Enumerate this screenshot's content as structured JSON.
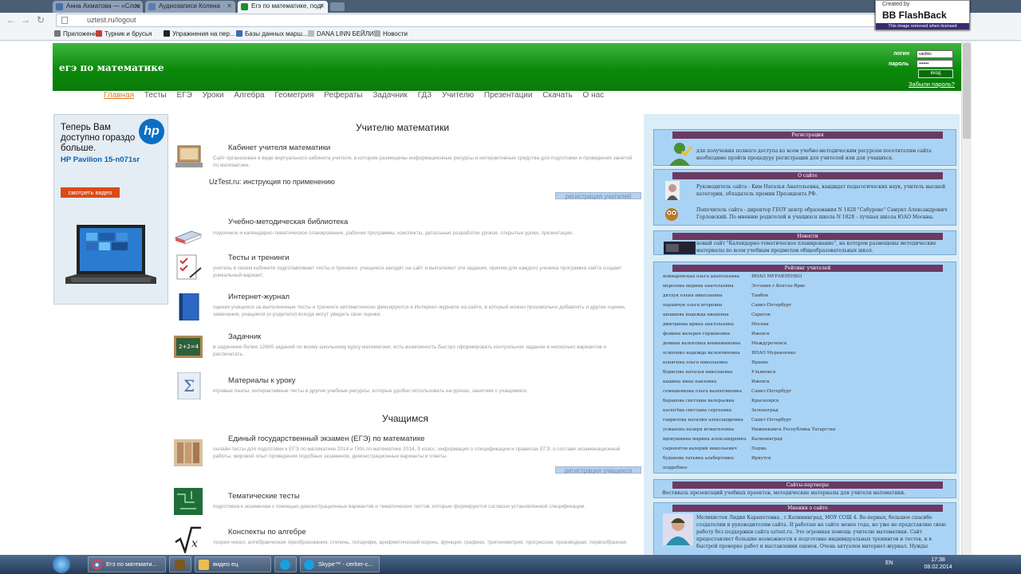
{
  "browser": {
    "tabs": [
      {
        "label": "Анна Ахматова — «Слов"
      },
      {
        "label": "Аудиозаписи Колена"
      },
      {
        "label": "Егэ по математике, подг"
      }
    ],
    "address": "uztest.ru/logout",
    "bookmarks": [
      "Приложения",
      "Турник и брусья",
      "Упражнения на пер...",
      "Базы данных марш...",
      "DANA LINN БЕЙЛИ",
      "Новости"
    ],
    "flashback": {
      "created_by": "Created by",
      "brand": "BB FlashBack",
      "note": "This image removed when licensed"
    }
  },
  "header": {
    "site_title": "егэ по математике",
    "login_label": "логин",
    "login_value": "vashko",
    "password_label": "пароль",
    "password_value": "•••••••",
    "enter_label": "вход",
    "forgot_label": "Забыли пароль?"
  },
  "menu": [
    "Главная",
    "Тесты",
    "ЕГЭ",
    "Уроки",
    "Алгебра",
    "Геометрия",
    "Рефераты",
    "Задачник",
    "ГДЗ",
    "Учителю",
    "Презентации",
    "Скачать",
    "О нас"
  ],
  "ad": {
    "text": "Теперь Вам доступно гораздо больше.",
    "model": "HP Pavilion 15-n071sr",
    "button": "смотреть видео",
    "logo": "hp"
  },
  "teachers": {
    "title": "Учителю математики",
    "items": [
      {
        "title": "Кабинет учителя математики",
        "desc": "Сайт организован в виде виртуального кабинета учителя, в котором размещены информационные ресурсы и интерактивные средства для подготовки и проведения занятий по математике."
      },
      {
        "title": "Учебно-методическая библиотека",
        "desc": "поурочное и календарно-тематическое планирование, рабочие программы, конспекты, детальные разработки уроков, открытые уроки, презентации."
      },
      {
        "title": "Тесты и тренинги",
        "desc": "учитель в своем кабинете подготавливает тесты и тренинги, учащиеся заходят на сайт и выполняют эти задания, причем для каждого ученика программа сайта создает уникальный вариант."
      },
      {
        "title": "Интернет-журнал",
        "desc": "оценки учащихся за выполненные тесты и тренинги автоматически фиксируются в Интернет-журнале на сайте, в который можно произвольно добавлять и другие оценки, замечания, учащиеся (и родители) всегда могут увидеть свои оценки."
      },
      {
        "title": "Задачник",
        "desc": "в задачнике более 12600 заданий по всему школьному курсу математики; есть возможность быстро сформировать контрольное задание в несколько вариантов и распечатать."
      },
      {
        "title": "Материалы к уроку",
        "desc": "игровые пазлы, интерактивные тесты и другие учебные ресурсы, которые удобно использовать на уроках, занятиях с учащимися."
      }
    ],
    "instructions_link": "UzTest.ru: инструкция по применению",
    "register_button": "регистрация учителей"
  },
  "students": {
    "title": "Учащимся",
    "items": [
      {
        "title": "Единый государственный экзамен (ЕГЭ) по математике",
        "desc": "онлайн тесты для подготовки к ЕГЭ по математике 2014 и ГИА по математике 2014, 9 класс, информация о спецификации и правилах ЕГЭ, о составе экзаменационной работы, мировой опыт проведения подобных экзаменов, демонстрационные варианты и ответы."
      },
      {
        "title": "Тематические тесты",
        "desc": "подготовка к экзаменам с помощью демонстрационных вариантов и тематических тестов, которые формируются согласно установленной спецификации."
      },
      {
        "title": "Конспекты по алгебре",
        "desc": "теория чисел, алгебраические преобразования, степень, логарифм, арифметический корень, функция, графики, тригонометрия, прогрессии, производная, первообразная"
      }
    ],
    "register_button": "регистрация учащихся"
  },
  "right": {
    "registration": {
      "title": "Регистрация",
      "text": "для получения полного доступа ко всем учебно-методическим ресурсам посетителям сайта необходимо пройти процедуру регистрации для учителей или для учащихся."
    },
    "about": {
      "title": "О сайте",
      "p1": "Руководитель сайта - Ким Наталья Анатольевна, кандидат педагогических наук, учитель высшей категории, обладатель премии Президента РФ.",
      "p2": "Попечитель сайта - директор ГБОУ центр образования N 1828 \"Сабурово\" Самуил Александрович Горловский. По мнению родителей и учащихся школа N 1828 - лучшая школа ЮАО Москвы."
    },
    "news": {
      "title": "Новости",
      "text": "новый сайт \"Календарно-тематическое планирование\", на котором размещены методические материалы по всем учебным предметам общеобразовательных школ."
    },
    "rating": {
      "title": "Рейтинг учителей",
      "rows": [
        {
          "name": "войнаровская ольга анатольевна",
          "place": "ЯНАО МУРАВЛЕНКО"
        },
        {
          "name": "морозова марина анатольевна",
          "place": "Эстония г.Кохтла-Ярве"
        },
        {
          "name": "дятлук елена николаевна",
          "place": "Тамбов"
        },
        {
          "name": "парамчук ольга игоревна",
          "place": "Санкт-Петербург"
        },
        {
          "name": "шешнева надежда ивановна",
          "place": "Саратов"
        },
        {
          "name": "дмитриева ирина анатольевна",
          "place": "Москва"
        },
        {
          "name": "фомина валерия германовна",
          "place": "Ижевск"
        },
        {
          "name": "демина валентина вениаминовна",
          "place": "Междуреченск"
        },
        {
          "name": "осипенко надежда валентиновна",
          "place": "ЯНАО Муравленко"
        },
        {
          "name": "конягина ольга николаевна",
          "place": "Ярцево"
        },
        {
          "name": "борисова наталья николаевна",
          "place": "Ульяновск"
        },
        {
          "name": "кашина нина павловна",
          "place": "Ижевск"
        },
        {
          "name": "семешенкова ольга валентиновна",
          "place": "Санкт-Петербург"
        },
        {
          "name": "баранова светлана валерьевна",
          "place": "Красноярск"
        },
        {
          "name": "касюгёва светлана сергеевна",
          "place": "Зеленоград"
        },
        {
          "name": "гаврилова наталия александровна",
          "place": "Санкт-Петербург"
        },
        {
          "name": "усманова назиря исмагиловна",
          "place": "Нижнекамск Республика Татарстан"
        },
        {
          "name": "вдовушкина марина александровна",
          "place": "Калининград"
        },
        {
          "name": "сыропятов валерий николаевич",
          "place": "Пермь"
        },
        {
          "name": "будакова татьяна альбертовна",
          "place": "Иркутск"
        }
      ],
      "more": "подробнее"
    },
    "partners": {
      "title": "Сайты-партнеры",
      "text": "Фестиваль презентаций учебных проектов, методические материалы для учителя математики."
    },
    "opinion": {
      "title": "Мнения о сайте",
      "text": "Мелихистея Лидия Карапетовна , г.Калининград, МОУ СОШ 4. Во-первых, большое спасибо создателям и руководителям сайта. Я работаю на сайте менее года, но уже не представляю свою работу без поддержки сайта uztest.ru. Это огромная помощь учителю математики. Сайт предоставляет большие возможности к подготовке индивидуальных тренингов и тестов, и в быстрой проверке работ и выставлении оценок. Очень актуален интернет-журнал. Нужды"
    }
  },
  "taskbar": {
    "items": [
      "Егэ по математи...",
      "",
      "видео ец",
      "",
      "Skype™ - cerber-c..."
    ],
    "lang": "EN",
    "time": "17:38",
    "date": "08.02.2014"
  },
  "colors": {
    "header_green": "#0a8a0a",
    "box_blue": "#a9d3f5",
    "box_header": "#6b3a63",
    "menu_active": "#e07b20"
  }
}
